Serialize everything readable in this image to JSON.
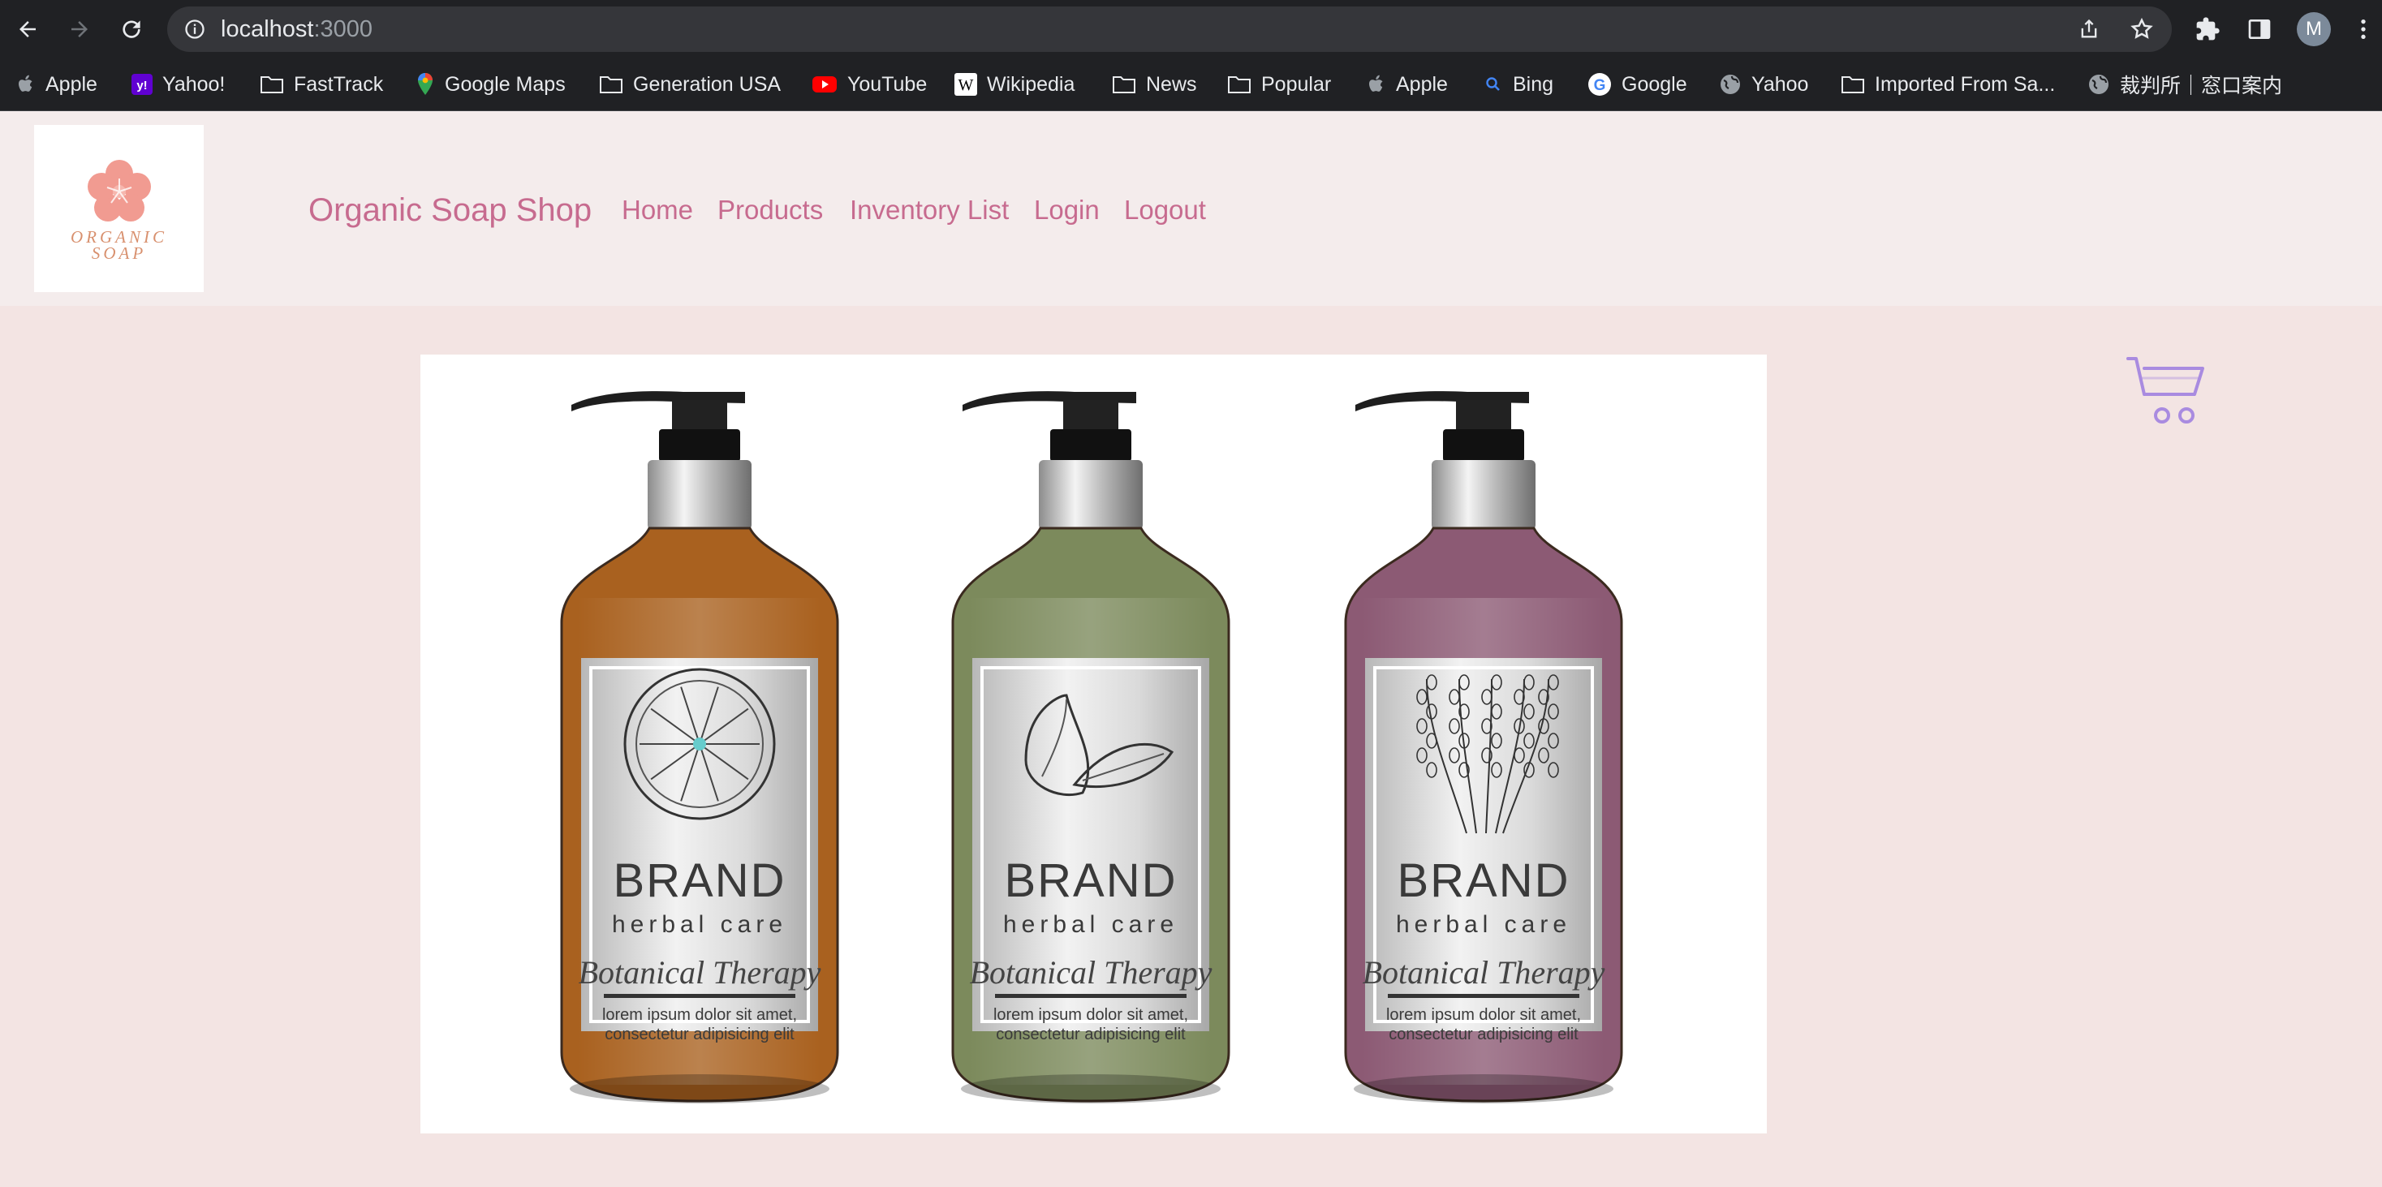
{
  "browser": {
    "url_host": "localhost",
    "url_port": ":3000",
    "profile_initial": "M",
    "bookmarks": [
      {
        "label": "Apple",
        "icon": "apple-icon"
      },
      {
        "label": "Yahoo!",
        "icon": "yahoo-icon"
      },
      {
        "label": "FastTrack",
        "icon": "folder-icon"
      },
      {
        "label": "Google Maps",
        "icon": "maps-pin-icon"
      },
      {
        "label": "Generation USA",
        "icon": "folder-icon"
      },
      {
        "label": "YouTube",
        "icon": "youtube-icon"
      },
      {
        "label": "Wikipedia",
        "icon": "wikipedia-icon"
      },
      {
        "label": "News",
        "icon": "folder-icon"
      },
      {
        "label": "Popular",
        "icon": "folder-icon"
      },
      {
        "label": "Apple",
        "icon": "apple-icon"
      },
      {
        "label": "Bing",
        "icon": "search-icon"
      },
      {
        "label": "Google",
        "icon": "google-icon"
      },
      {
        "label": "Yahoo",
        "icon": "globe-icon"
      },
      {
        "label": "Imported From Sa...",
        "icon": "folder-icon"
      },
      {
        "label": "裁判所｜窓口案内",
        "icon": "globe-icon"
      }
    ]
  },
  "site": {
    "logo_line1": "ORGANIC",
    "logo_line2": "SOAP",
    "brand": "Organic Soap Shop",
    "nav": [
      "Home",
      "Products",
      "Inventory List",
      "Login",
      "Logout"
    ]
  },
  "hero": {
    "bottles": [
      {
        "brand": "BRAND",
        "sub": "herbal care",
        "script": "Botanical Therapy",
        "desc1": "lorem ipsum dolor sit amet,",
        "desc2": "consectetur adipisicing elit",
        "liquid": "#a9611f",
        "illustration": "citrus-slice-icon"
      },
      {
        "brand": "BRAND",
        "sub": "herbal care",
        "script": "Botanical Therapy",
        "desc1": "lorem ipsum dolor sit amet,",
        "desc2": "consectetur adipisicing elit",
        "liquid": "#7c8a5c",
        "illustration": "leaf-icon"
      },
      {
        "brand": "BRAND",
        "sub": "herbal care",
        "script": "Botanical Therapy",
        "desc1": "lorem ipsum dolor sit amet,",
        "desc2": "consectetur adipisicing elit",
        "liquid": "#8c5a74",
        "illustration": "lavender-icon"
      }
    ]
  },
  "colors": {
    "accent": "#c76b8f",
    "header_bg": "#f4ecec",
    "page_bg": "#f3e4e3",
    "cart": "#a98be0"
  }
}
